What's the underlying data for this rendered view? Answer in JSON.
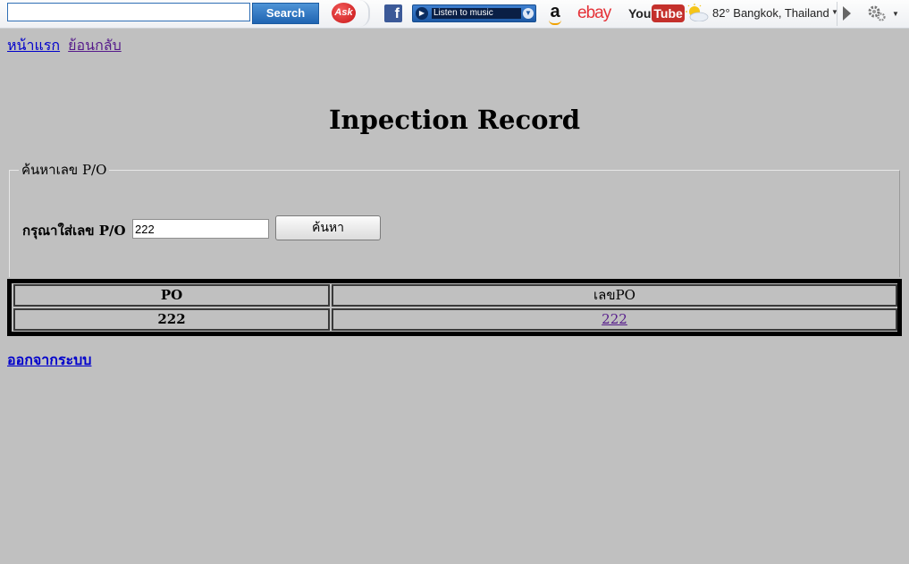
{
  "toolbar": {
    "search_value": "",
    "search_button": "Search",
    "ask_label": "Ask",
    "facebook_label": "f",
    "music_label": "Listen to music",
    "amazon_label": "a",
    "ebay_label": "ebay",
    "youtube_you": "You",
    "youtube_tube": "Tube",
    "weather": "82° Bangkok, Thailand",
    "icons": {
      "weather": "partly-cloudy-icon",
      "settings": "gear-icon",
      "more": "play-arrow-icon"
    }
  },
  "nav": {
    "home": "หน้าแรก",
    "back": "ย้อนกลับ"
  },
  "page": {
    "title": "Inpection Record"
  },
  "search": {
    "legend": "ค้นหาเลข P/O",
    "label": "กรุณาใส่เลข P/O",
    "value": "222",
    "button": "ค้นหา"
  },
  "table": {
    "headers": [
      "PO",
      "เลขPO"
    ],
    "rows": [
      {
        "po": "222",
        "po_link": "222"
      }
    ]
  },
  "footer": {
    "logout": "ออกจากระบบ"
  },
  "colors": {
    "page_background": "#c0c0c0",
    "link": "#0000cc",
    "visited_link": "#551a8b"
  }
}
